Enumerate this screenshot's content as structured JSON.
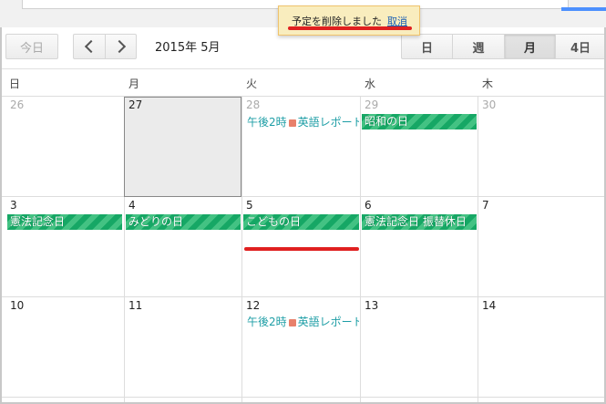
{
  "toolbar": {
    "today_label": "今日",
    "current_period": "2015年 5月",
    "views": [
      "日",
      "週",
      "月",
      "4日"
    ],
    "active_view": "月"
  },
  "toast": {
    "message": "予定を削除しました",
    "undo_label": "取消"
  },
  "weekdays": [
    "日",
    "月",
    "火",
    "水",
    "木"
  ],
  "weeks": [
    {
      "days": [
        "26",
        "27",
        "28",
        "29",
        "30"
      ]
    },
    {
      "days": [
        "3",
        "4",
        "5",
        "6",
        "7"
      ]
    },
    {
      "days": [
        "10",
        "11",
        "12",
        "13",
        "14"
      ]
    }
  ],
  "events": {
    "w1_tue_timed": {
      "time": "午後2時",
      "title": "英語レポート"
    },
    "w1_wed_allday": "昭和の日",
    "w2_sun_allday": "憲法記念日",
    "w2_mon_allday": "みどりの日",
    "w2_tue_allday": "こどもの日",
    "w2_wed_allday": "憲法記念日 振替休日",
    "w3_tue_timed": {
      "time": "午後2時",
      "title": "英語レポート"
    }
  },
  "colors": {
    "holiday_event": "#16a765",
    "timed_event_text": "#1e9ea6",
    "timed_event_dot": "#e8806b",
    "annotation_red": "#e02020",
    "toast_bg": "#f9edbe"
  }
}
